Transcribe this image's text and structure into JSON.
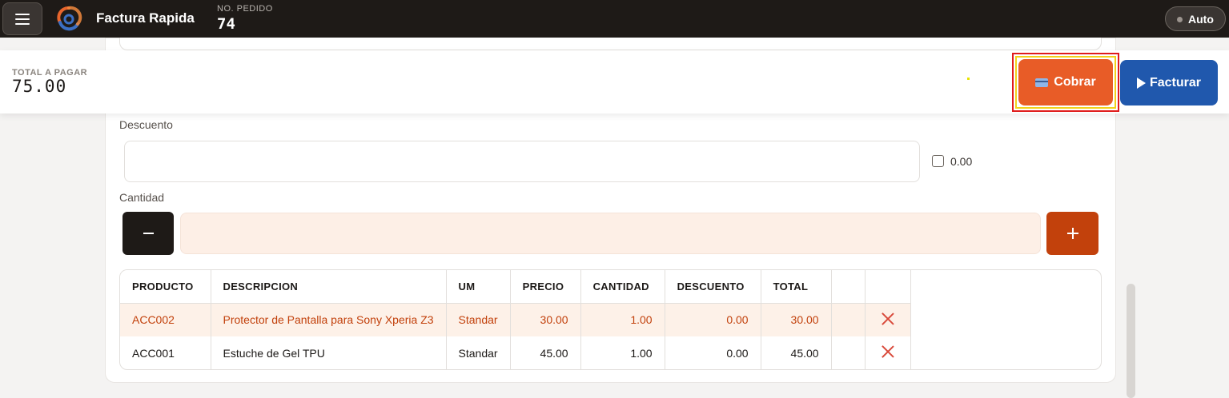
{
  "header": {
    "app_title": "Factura Rapida",
    "order_label": "NO. PEDIDO",
    "order_number": "74",
    "mode_label": "Auto"
  },
  "summary": {
    "total_label": "TOTAL A PAGAR",
    "total_value": "75.00",
    "charge_label": "Cobrar",
    "invoice_label": "Facturar"
  },
  "form": {
    "discount_label": "Descuento",
    "discount_value": "",
    "discount_amount": "0.00",
    "quantity_label": "Cantidad",
    "quantity_value": "",
    "minus_label": "−",
    "plus_label": "+"
  },
  "table": {
    "columns": [
      "PRODUCTO",
      "DESCRIPCION",
      "UM",
      "PRECIO",
      "CANTIDAD",
      "DESCUENTO",
      "TOTAL",
      "",
      ""
    ],
    "rows": [
      {
        "producto": "ACC002",
        "descripcion": "Protector de Pantalla para Sony Xperia Z3",
        "um": "Standar",
        "precio": "30.00",
        "cantidad": "1.00",
        "descuento": "0.00",
        "total": "30.00"
      },
      {
        "producto": "ACC001",
        "descripcion": "Estuche de Gel TPU",
        "um": "Standar",
        "precio": "45.00",
        "cantidad": "1.00",
        "descuento": "0.00",
        "total": "45.00"
      }
    ]
  },
  "colors": {
    "topbar": "#1e1a17",
    "charge_button": "#e85c27",
    "invoice_button": "#2058ad",
    "plus_button": "#c2410c",
    "highlight_row": "#fdf1e8"
  },
  "icons": [
    "menu-icon",
    "logo-icon",
    "card-icon",
    "play-icon",
    "minus-icon",
    "plus-icon",
    "delete-icon"
  ]
}
